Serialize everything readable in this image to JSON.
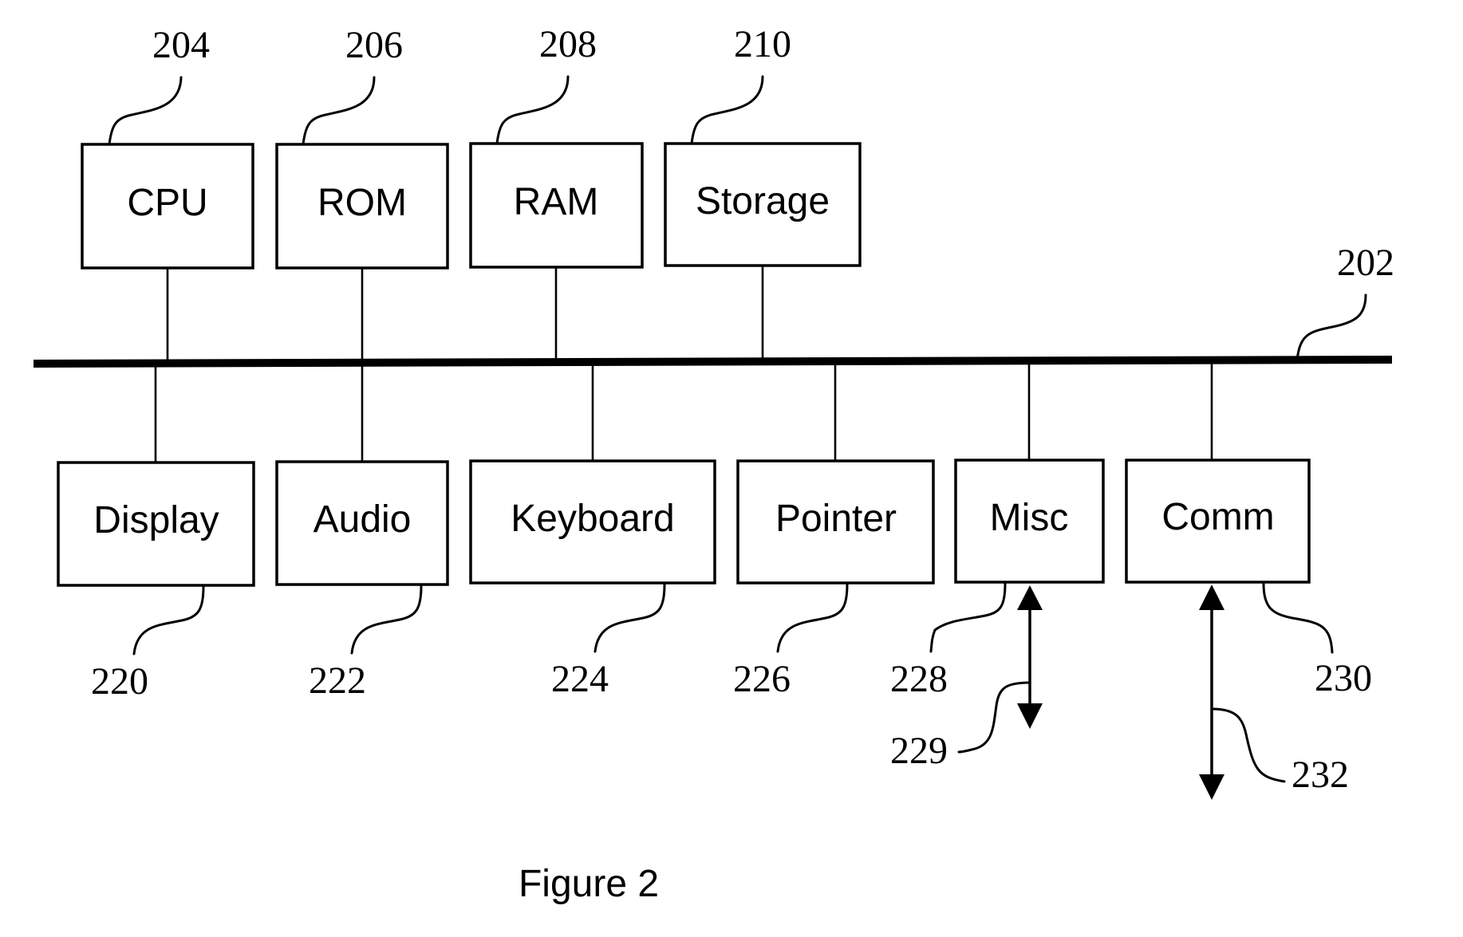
{
  "figure": {
    "caption": "Figure 2",
    "bus": {
      "ref": "202"
    },
    "top_components": [
      {
        "label": "CPU",
        "ref": "204"
      },
      {
        "label": "ROM",
        "ref": "206"
      },
      {
        "label": "RAM",
        "ref": "208"
      },
      {
        "label": "Storage",
        "ref": "210"
      }
    ],
    "bottom_components": [
      {
        "label": "Display",
        "ref": "220"
      },
      {
        "label": "Audio",
        "ref": "222"
      },
      {
        "label": "Keyboard",
        "ref": "224"
      },
      {
        "label": "Pointer",
        "ref": "226"
      },
      {
        "label": "Misc",
        "ref": "228"
      },
      {
        "label": "Comm",
        "ref": "230"
      }
    ],
    "external_links": [
      {
        "ref": "229",
        "from": "Misc",
        "direction": "bidirectional"
      },
      {
        "ref": "232",
        "from": "Comm",
        "direction": "bidirectional"
      }
    ]
  }
}
